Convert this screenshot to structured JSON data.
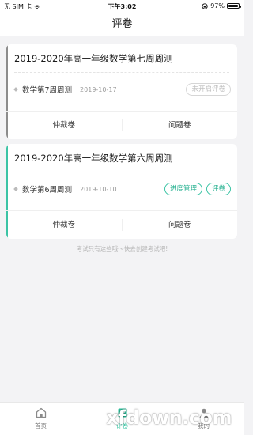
{
  "status_bar": {
    "carrier": "无 SIM 卡",
    "time": "下午3:02",
    "battery": "97%"
  },
  "nav": {
    "title": "评卷"
  },
  "colors": {
    "accent": "#2bbf9b",
    "card1_bar": "#8c8c8c",
    "card2_bar": "#3cc4a5"
  },
  "cards": [
    {
      "title": "2019-2020年高一年级数学第七周周测",
      "subject": "数学第7周周测",
      "date": "2019-10-17",
      "actions": [
        {
          "label": "未开启评卷",
          "state": "disabled"
        }
      ],
      "footer": {
        "left": "仲裁卷",
        "right": "问题卷"
      }
    },
    {
      "title": "2019-2020年高一年级数学第六周周测",
      "subject": "数学第6周周测",
      "date": "2019-10-10",
      "actions": [
        {
          "label": "进度管理",
          "state": "active"
        },
        {
          "label": "评卷",
          "state": "active"
        }
      ],
      "footer": {
        "left": "仲裁卷",
        "right": "问题卷"
      }
    }
  ],
  "hint": "考试只有这些哦～快去创建考试吧!",
  "tabs": [
    {
      "label": "首页",
      "icon": "home-icon"
    },
    {
      "label": "评卷",
      "icon": "grading-icon",
      "active": true
    },
    {
      "label": "我的",
      "icon": "profile-icon"
    }
  ],
  "watermark": "xfdown.com"
}
